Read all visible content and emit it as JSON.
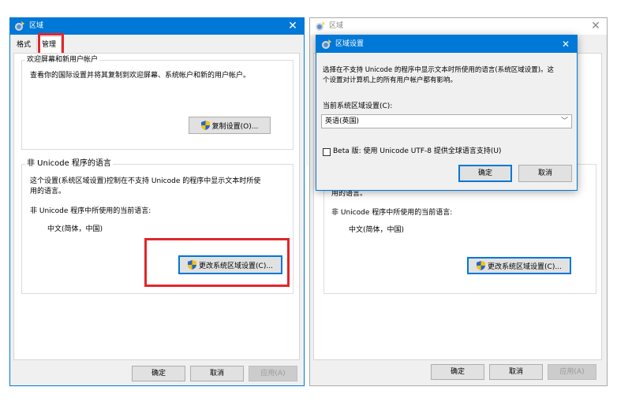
{
  "left_window": {
    "title": "区域",
    "tabs": [
      "格式",
      "管理"
    ],
    "welcome": {
      "legend": "欢迎屏幕和新用户帐户",
      "description": "查看你的国际设置并将其复制到欢迎屏幕、系统帐户和新的用户帐户。",
      "copy_button": "复制设置(O)..."
    },
    "unicode": {
      "legend": "非 Unicode 程序的语言",
      "description_line1": "这个设置(系统区域设置)控制在不支持 Unicode 的程序中显示文本时所使",
      "description_line2": "用的语言。",
      "current_label": "非 Unicode 程序中所使用的当前语言:",
      "current_value": "中文(简体，中国)",
      "change_button": "更改系统区域设置(C)..."
    },
    "buttons": {
      "ok": "确定",
      "cancel": "取消",
      "apply": "应用(A)"
    }
  },
  "right_window": {
    "title": "区域",
    "background_text": {
      "line2": "用的语言。",
      "current_label": "非 Unicode 程序中所使用的当前语言:",
      "current_value": "中文(简体，中国)",
      "change_button": "更改系统区域设置(C)..."
    },
    "buttons": {
      "ok": "确定",
      "cancel": "取消",
      "apply": "应用(A)"
    }
  },
  "dialog": {
    "title": "区域设置",
    "description_line1": "选择在不支持 Unicode 的程序中显示文本时所使用的语言(系统区域设置)。这",
    "description_line2": "个设置对计算机上的所有用户帐户都有影响。",
    "current_label": "当前系统区域设置(C):",
    "current_value": "英语(英国)",
    "beta_label": "Beta 版: 使用 Unicode UTF-8 提供全球语言支持(U)",
    "beta_checked": false,
    "ok": "确定",
    "cancel": "取消"
  },
  "colors": {
    "highlight": "#e2262c",
    "accent": "#0078d7",
    "title_blue": "#0078d7"
  }
}
